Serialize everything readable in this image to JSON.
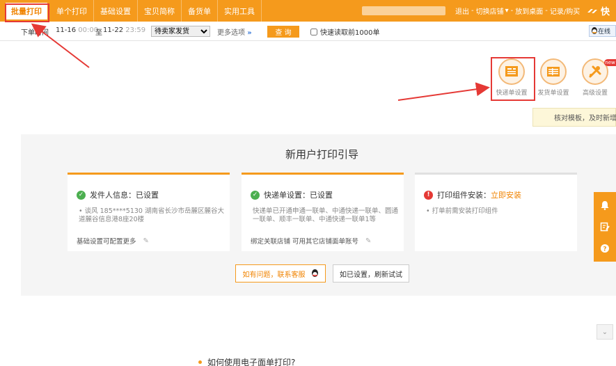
{
  "topbar": {
    "tabs": [
      "批量打印",
      "单个打印",
      "基础设置",
      "宝贝简称",
      "备货单",
      "实用工具"
    ],
    "right": [
      "退出",
      "-",
      "切换店铺",
      "▾",
      "-",
      "放到桌面",
      "-",
      "记录/购买"
    ],
    "brand": "快"
  },
  "filter": {
    "label": "下单时间",
    "from_date": "11-16",
    "from_time": "00:00",
    "to": "至",
    "to_date": "11-22",
    "to_time": "23:59",
    "status_selected": "待卖家发货",
    "more": "更多选项",
    "more_arrow": "»",
    "query": "查 询",
    "quick_read": "快速读取前1000单",
    "online": "在线"
  },
  "tool_icons": [
    {
      "label": "快递单设置",
      "icon": "waybill-icon"
    },
    {
      "label": "发货单设置",
      "icon": "invoice-icon"
    },
    {
      "label": "高级设置",
      "icon": "tools-icon"
    }
  ],
  "new_badge": "new",
  "tip": "核对模板，及时新增",
  "guide": {
    "title": "新用户打印引导",
    "cards": [
      {
        "title": "发件人信息：已设置",
        "body": "• 谈风 185****5130 湖南省长沙市岳麓区麓谷大道麓谷信息港8座20楼",
        "footer": "基础设置可配置更多"
      },
      {
        "title": "快递单设置：已设置",
        "body": "快递单已开通申通一联单、中通快递一联单、圆通一联单、顺丰一联单、中通快递一联单1等",
        "footer": "绑定关联店铺 可用其它店铺面单账号"
      },
      {
        "title": "打印组件安装：",
        "link": "立即安装",
        "body": "• 打单前需安装打印组件"
      }
    ],
    "contact": "如有问题，联系客服",
    "refresh": "如已设置，刷新试试"
  },
  "faq": "如何使用电子面单打印?",
  "colors": {
    "accent": "#f59a1c",
    "highlight": "#e53935",
    "ok": "#4caf50"
  }
}
